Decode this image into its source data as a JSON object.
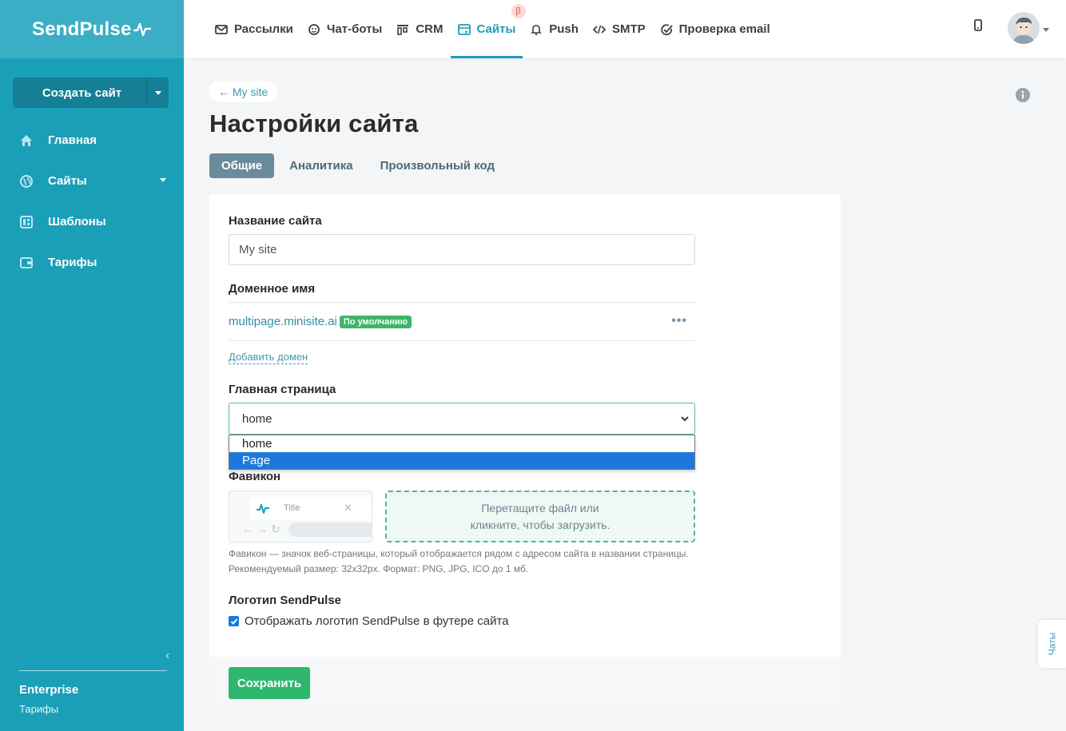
{
  "brand": {
    "name": "SendPulse"
  },
  "sidebar": {
    "create_button": "Создать сайт",
    "items": [
      {
        "label": "Главная",
        "icon": "home-icon"
      },
      {
        "label": "Сайты",
        "icon": "globe-icon",
        "has_submenu": true
      },
      {
        "label": "Шаблоны",
        "icon": "templates-icon"
      },
      {
        "label": "Тарифы",
        "icon": "wallet-icon"
      }
    ],
    "plan_name": "Enterprise",
    "plan_link": "Тарифы"
  },
  "topnav": {
    "items": [
      {
        "label": "Рассылки",
        "icon": "mail-icon"
      },
      {
        "label": "Чат-боты",
        "icon": "chatbot-icon"
      },
      {
        "label": "CRM",
        "icon": "crm-icon"
      },
      {
        "label": "Сайты",
        "icon": "sites-icon",
        "active": true,
        "badge": "β"
      },
      {
        "label": "Push",
        "icon": "bell-icon"
      },
      {
        "label": "SMTP",
        "icon": "code-icon"
      },
      {
        "label": "Проверка email",
        "icon": "check-circle-icon"
      }
    ]
  },
  "page": {
    "back_link": "← My site",
    "title": "Настройки сайта",
    "tabs": [
      "Общие",
      "Аналитика",
      "Произвольный код"
    ],
    "active_tab": "Общие"
  },
  "form": {
    "site_name_label": "Название сайта",
    "site_name_value": "My site",
    "domain_label": "Доменное имя",
    "domain": "multipage.minisite.ai",
    "domain_badge": "По умолчанию",
    "add_domain": "Добавить домен",
    "home_page_label": "Главная страница",
    "home_page_value": "home",
    "home_page_options": [
      "home",
      "Page"
    ],
    "highlighted_option": "Page",
    "favicon_label": "Фавикон",
    "favicon_preview_title": "Title",
    "favicon_drop_line1": "Перетащите файл или",
    "favicon_drop_line2": "кликните, чтобы загрузить.",
    "favicon_hint": "Фавикон — значок веб-страницы, который отображается рядом с адресом сайта в названии страницы. Рекомендуемый размер: 32x32px. Формат: PNG, JPG, ICO до 1 мб.",
    "logo_label": "Логотип SendPulse",
    "logo_checkbox": "Отображать логотип SendPulse в футере сайта",
    "logo_checked": true,
    "save": "Сохранить"
  },
  "chats_tab": "Чаты",
  "colors": {
    "sidebar": "#1a9fb9",
    "accent": "#1a9fb9",
    "save": "#2fb66f",
    "badge": "#3fb56a"
  }
}
